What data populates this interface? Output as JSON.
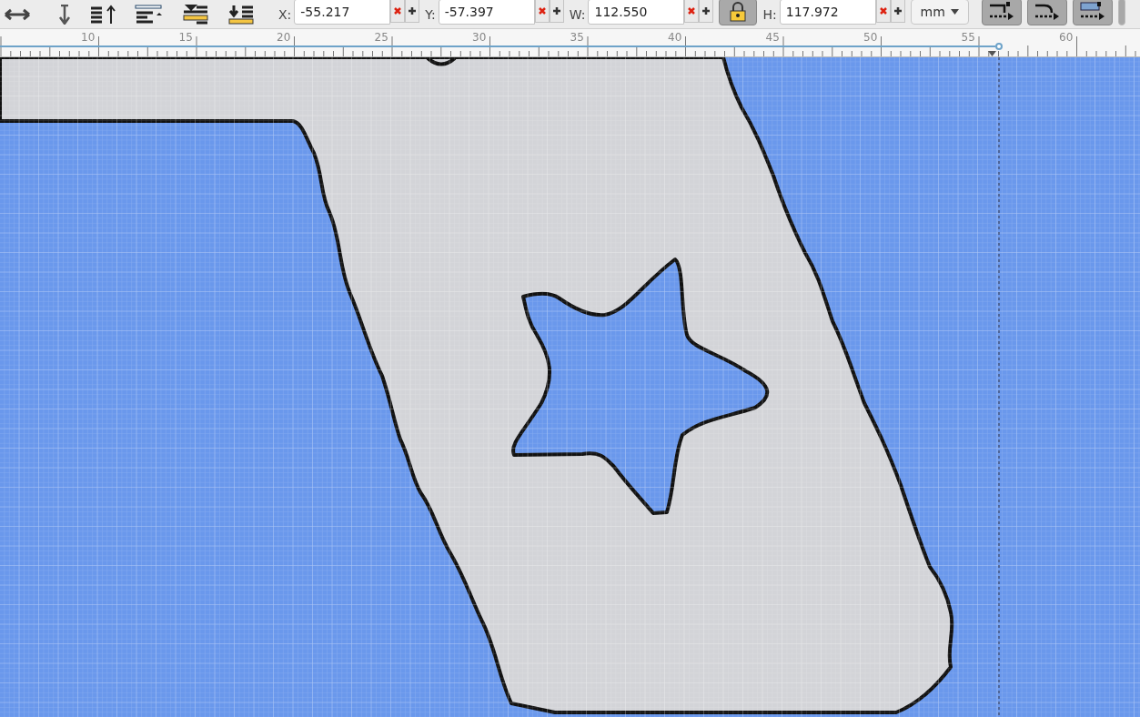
{
  "toolbar": {
    "fields": [
      {
        "label": "X:",
        "value": "-55.217"
      },
      {
        "label": "Y:",
        "value": "-57.397"
      },
      {
        "label": "W:",
        "value": "112.550"
      },
      {
        "label": "H:",
        "value": "117.972"
      }
    ],
    "lock": {
      "on": true
    },
    "unit": "mm",
    "toggles": [
      {
        "on": true
      },
      {
        "on": true
      },
      {
        "on": true
      }
    ]
  },
  "ruler": {
    "labels": [
      "10",
      "15",
      "20",
      "25",
      "30",
      "35",
      "40",
      "45",
      "50",
      "55",
      "60"
    ]
  }
}
